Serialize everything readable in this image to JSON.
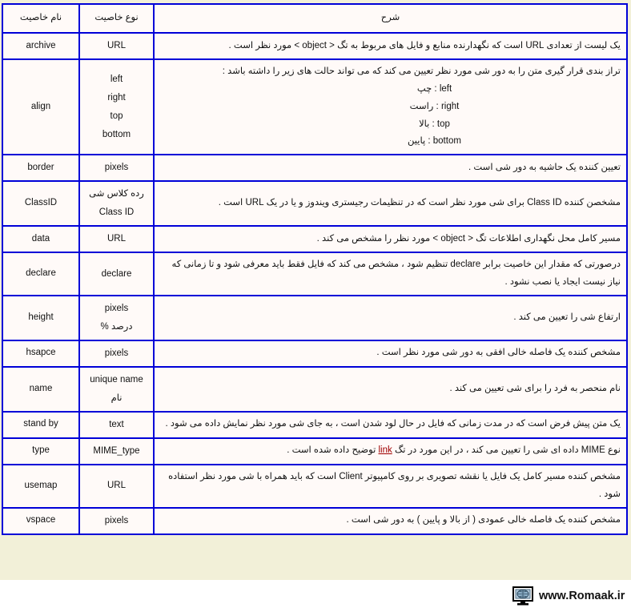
{
  "table": {
    "headers": {
      "name": "نام خاصیت",
      "type": "نوع خاصیت",
      "description": "شرح"
    },
    "rows": [
      {
        "name": "archive",
        "type": [
          "URL"
        ],
        "desc": [
          "یک لیست از تعدادی URL است که نگهدارنده منابع و فایل های مربوط به تگ < object > مورد نظر است ."
        ]
      },
      {
        "name": "align",
        "type": [
          "left",
          "right",
          "top",
          "bottom"
        ],
        "desc": [
          "تراز بندی قرار گیری متن را به دور شی مورد نظر تعیین می کند که می تواند حالت های زیر را داشته باشد :",
          "left : چپ",
          "right : راست",
          "top : بالا",
          "bottom : پایین"
        ]
      },
      {
        "name": "border",
        "type": [
          "pixels"
        ],
        "desc": [
          "تعیین کننده یک حاشیه به دور شی است ."
        ]
      },
      {
        "name": "ClassID",
        "type": [
          "رده کلاس شی",
          "Class ID"
        ],
        "desc": [
          "مشخصن کننده Class ID برای شی مورد نظر است که در تنظیمات رجیستری ویندوز و یا در یک URL است ."
        ]
      },
      {
        "name": "data",
        "type": [
          "URL"
        ],
        "desc": [
          "مسیر کامل محل نگهداری اطلاعات تگ < object > مورد نظر را مشخص می کند ."
        ]
      },
      {
        "name": "declare",
        "type": [
          "declare"
        ],
        "desc": [
          "درصورتی که مقدار این خاصیت برابر declare تنظیم شود ، مشخص می کند که فایل فقط باید معرفی شود و تا زمانی که نیاز نیست ایجاد یا نصب نشود ."
        ]
      },
      {
        "name": "height",
        "type": [
          "pixels",
          "درصد %"
        ],
        "desc": [
          "ارتفاع شی را تعیین می کند ."
        ]
      },
      {
        "name": "hsapce",
        "type": [
          "pixels"
        ],
        "desc": [
          "مشخص کننده یک فاصله خالی افقی به دور شی مورد نظر است ."
        ]
      },
      {
        "name": "name",
        "type": [
          "unique name",
          "نام"
        ],
        "desc": [
          "نام منحصر به فرد را برای شی تعیین می کند ."
        ]
      },
      {
        "name": "stand by",
        "type": [
          "text"
        ],
        "desc": [
          "یک متن پیش فرض است که در مدت زمانی که فایل در حال لود شدن است ، به جای شی مورد نظر نمایش داده می شود ."
        ]
      },
      {
        "name": "type",
        "type": [
          "MIME_type"
        ],
        "desc_pre": "نوع MIME داده ای شی را تعیین می کند ، در این مورد در تگ ",
        "desc_link": "link",
        "desc_post": " توضیح داده شده است ."
      },
      {
        "name": "usemap",
        "type": [
          "URL"
        ],
        "desc": [
          "مشخص کننده مسیر کامل یک فایل یا نقشه تصویری بر روی کامپیوتر Client است که باید همراه با شی مورد نظر استفاده شود ."
        ]
      },
      {
        "name": "vspace",
        "type": [
          "pixels"
        ],
        "desc": [
          "مشخص کننده یک فاصله خالی عمودی ( از بالا و پایین ) به دور شی است ."
        ]
      }
    ]
  },
  "footer": {
    "site_url": "www.Romaak.ir",
    "logo_icon": "computer-globe-icon"
  },
  "colors": {
    "page_background": "#f2f0d8",
    "cell_background": "#fffaf8",
    "border": "#0000d8",
    "header_text": "#b05a12",
    "body_text": "#111111",
    "link": "#a00000",
    "footer_background": "#ffffff"
  }
}
